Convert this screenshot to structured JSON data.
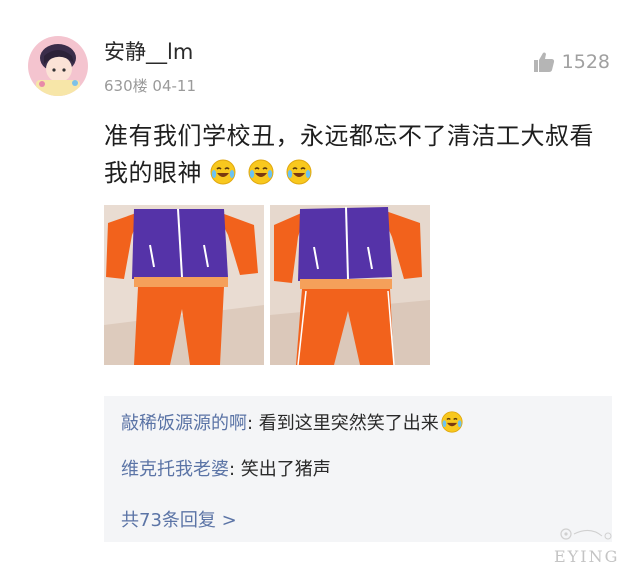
{
  "post": {
    "username": "安静__lm",
    "floor_date": "630楼 04-11",
    "like_count": "1528",
    "text": "准有我们学校丑，永远都忘不了清洁工大叔看我的眼神",
    "emoji_icon": "laughing-tears-emoji"
  },
  "replies": [
    {
      "author": "敲稀饭源源的啊",
      "sep": ": ",
      "text": "看到这里突然笑了出来"
    },
    {
      "author": "维克托我老婆",
      "sep": ": ",
      "text": "笑出了猪声"
    }
  ],
  "more_replies": "共73条回复 >",
  "watermark": "EYING",
  "colors": {
    "link_blue": "#5b74a6",
    "meta_gray": "#9a9a9a",
    "reply_bg": "#f4f5f7",
    "tracksuit_orange": "#f2621c",
    "tracksuit_purple": "#5533a8"
  }
}
